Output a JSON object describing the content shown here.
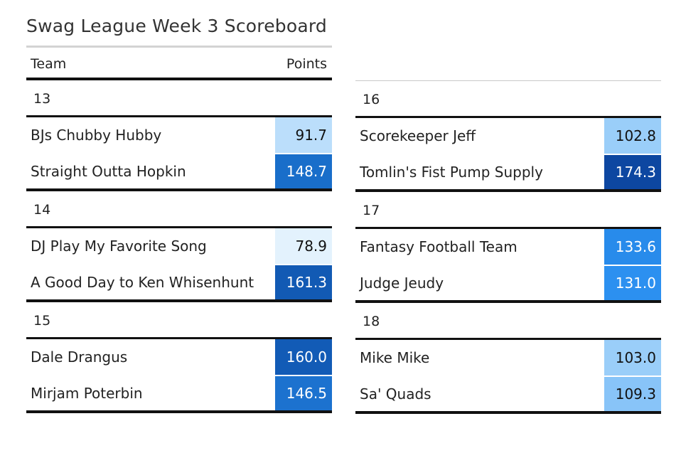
{
  "chart_data": {
    "type": "table",
    "title": "Swag League Week 3 Scoreboard",
    "columns": [
      "Team",
      "Points"
    ],
    "groups": [
      {
        "label": "13",
        "rows": [
          {
            "team": "BJs Chubby Hubby",
            "points": "91.7"
          },
          {
            "team": "Straight Outta Hopkin",
            "points": "148.7"
          }
        ]
      },
      {
        "label": "14",
        "rows": [
          {
            "team": "DJ Play My Favorite Song",
            "points": "78.9"
          },
          {
            "team": "A Good Day to Ken Whisenhunt",
            "points": "161.3"
          }
        ]
      },
      {
        "label": "15",
        "rows": [
          {
            "team": "Dale Drangus",
            "points": "160.0"
          },
          {
            "team": "Mirjam Poterbin",
            "points": "146.5"
          }
        ]
      },
      {
        "label": "16",
        "rows": [
          {
            "team": "Scorekeeper Jeff",
            "points": "102.8"
          },
          {
            "team": "Tomlin's Fist Pump Supply",
            "points": "174.3"
          }
        ]
      },
      {
        "label": "17",
        "rows": [
          {
            "team": "Fantasy Football Team",
            "points": "133.6"
          },
          {
            "team": "Judge Jeudy",
            "points": "131.0"
          }
        ]
      },
      {
        "label": "18",
        "rows": [
          {
            "team": "Mike Mike",
            "points": "103.0"
          },
          {
            "team": "Sa' Quads",
            "points": "109.3"
          }
        ]
      }
    ],
    "color_scale": {
      "low_color": "#e3f2fd",
      "high_color": "#0d47a1"
    }
  }
}
